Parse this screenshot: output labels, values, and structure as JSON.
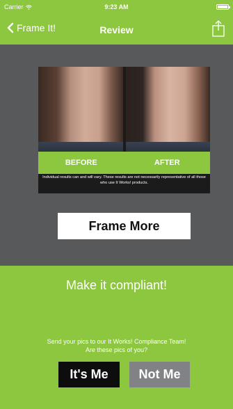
{
  "status_bar": {
    "carrier": "Carrier",
    "time": "9:23 AM"
  },
  "nav": {
    "back_label": "Frame It!",
    "title": "Review"
  },
  "photo": {
    "before_label": "BEFORE",
    "after_label": "AFTER",
    "disclaimer": "Individual results can and will vary. These results are not necessarily representative of all those who use It Works! products."
  },
  "actions": {
    "frame_more_label": "Frame More"
  },
  "compliance": {
    "title": "Make it compliant!",
    "prompt_line1": "Send your pics to our It Works! Compliance Team!",
    "prompt_line2": "Are these pics of you?",
    "yes_label": "It's Me",
    "no_label": "Not Me"
  },
  "colors": {
    "brand_green": "#8dc63f",
    "panel_gray": "#58595b",
    "button_black": "#0d0d0d",
    "button_gray": "#808285"
  },
  "icons": {
    "back": "chevron-left-icon",
    "share": "share-icon",
    "wifi": "wifi-icon",
    "battery": "battery-icon"
  }
}
